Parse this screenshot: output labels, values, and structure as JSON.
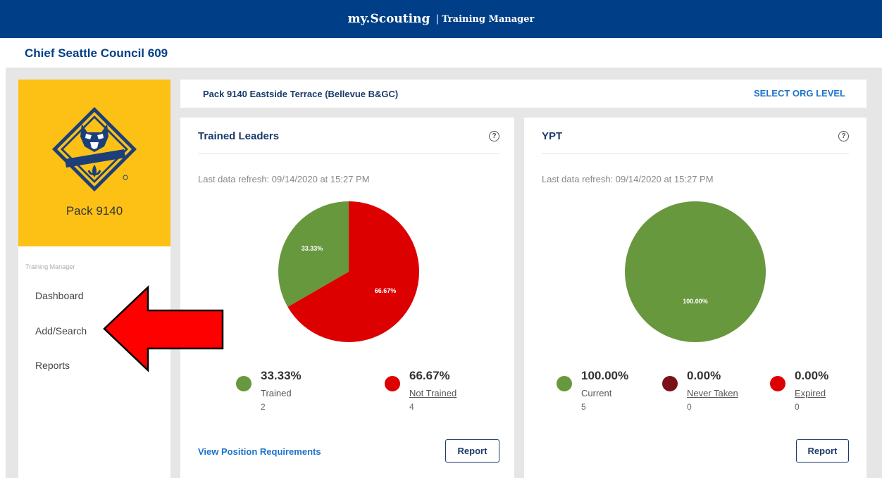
{
  "header": {
    "brand": "my.Scouting",
    "separator": "|",
    "app": "Training Manager"
  },
  "council": "Chief Seattle Council 609",
  "sidebar": {
    "unit_name": "Pack 9140",
    "nav_heading": "Training Manager",
    "items": [
      {
        "label": "Dashboard"
      },
      {
        "label": "Add/Search"
      },
      {
        "label": "Reports"
      }
    ]
  },
  "org": {
    "name": "Pack 9140 Eastside Terrace (Bellevue B&GC)",
    "select_label": "SELECT ORG LEVEL"
  },
  "colors": {
    "navy": "#003f87",
    "green": "#68983d",
    "red": "#dd0000",
    "maroon": "#7b1118",
    "gold": "#fdc116",
    "arrow": "#ff0000"
  },
  "trained_card": {
    "title": "Trained Leaders",
    "help": "?",
    "refresh": "Last data refresh: 09/14/2020 at 15:27 PM",
    "chart_data": {
      "type": "pie",
      "slices": [
        {
          "label": "Trained",
          "value": 33.33,
          "text": "33.33%",
          "color": "#68983d"
        },
        {
          "label": "Not Trained",
          "value": 66.67,
          "text": "66.67%",
          "color": "#dd0000"
        }
      ]
    },
    "legend": [
      {
        "pct": "33.33%",
        "label": "Trained",
        "count": "2",
        "color": "#68983d"
      },
      {
        "pct": "66.67%",
        "label": "Not Trained",
        "count": "4",
        "color": "#dd0000"
      }
    ],
    "view_link": "View Position Requirements",
    "report_button": "Report"
  },
  "ypt_card": {
    "title": "YPT",
    "help": "?",
    "refresh": "Last data refresh: 09/14/2020 at 15:27 PM",
    "chart_data": {
      "type": "pie",
      "slices": [
        {
          "label": "Current",
          "value": 100.0,
          "text": "100.00%",
          "color": "#68983d"
        },
        {
          "label": "Never Taken",
          "value": 0.0,
          "text": "0.00%",
          "color": "#7b1118"
        },
        {
          "label": "Expired",
          "value": 0.0,
          "text": "0.00%",
          "color": "#dd0000"
        }
      ]
    },
    "legend": [
      {
        "pct": "100.00%",
        "label": "Current",
        "count": "5",
        "color": "#68983d"
      },
      {
        "pct": "0.00%",
        "label": "Never Taken",
        "count": "0",
        "color": "#7b1118"
      },
      {
        "pct": "0.00%",
        "label": "Expired",
        "count": "0",
        "color": "#dd0000"
      }
    ],
    "report_button": "Report"
  }
}
